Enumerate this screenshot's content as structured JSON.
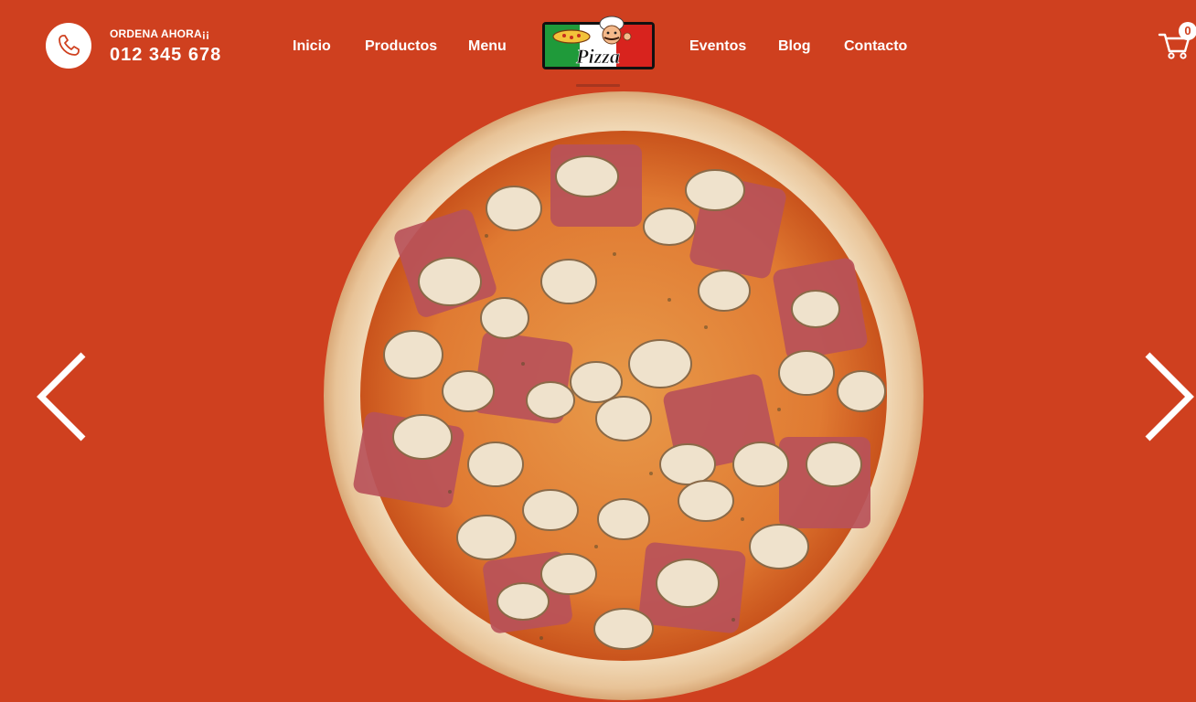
{
  "header": {
    "order_label": "ORDENA AHORA¡¡",
    "phone_number": "012 345 678",
    "phone_icon": "phone-icon"
  },
  "nav": {
    "left": [
      {
        "label": "Inicio"
      },
      {
        "label": "Productos"
      },
      {
        "label": "Menu"
      }
    ],
    "right": [
      {
        "label": "Eventos"
      },
      {
        "label": "Blog"
      },
      {
        "label": "Contacto"
      }
    ]
  },
  "logo": {
    "text": "Pizza",
    "flag_colors": [
      "#1f9a3a",
      "#ffffff",
      "#d8231e"
    ]
  },
  "cart": {
    "icon": "cart-icon",
    "count": "0"
  },
  "slider": {
    "image": "pizza-mushroom-ham",
    "prev_icon": "chevron-left-icon",
    "next_icon": "chevron-right-icon"
  },
  "colors": {
    "background": "#cf401f",
    "text": "#ffffff"
  }
}
